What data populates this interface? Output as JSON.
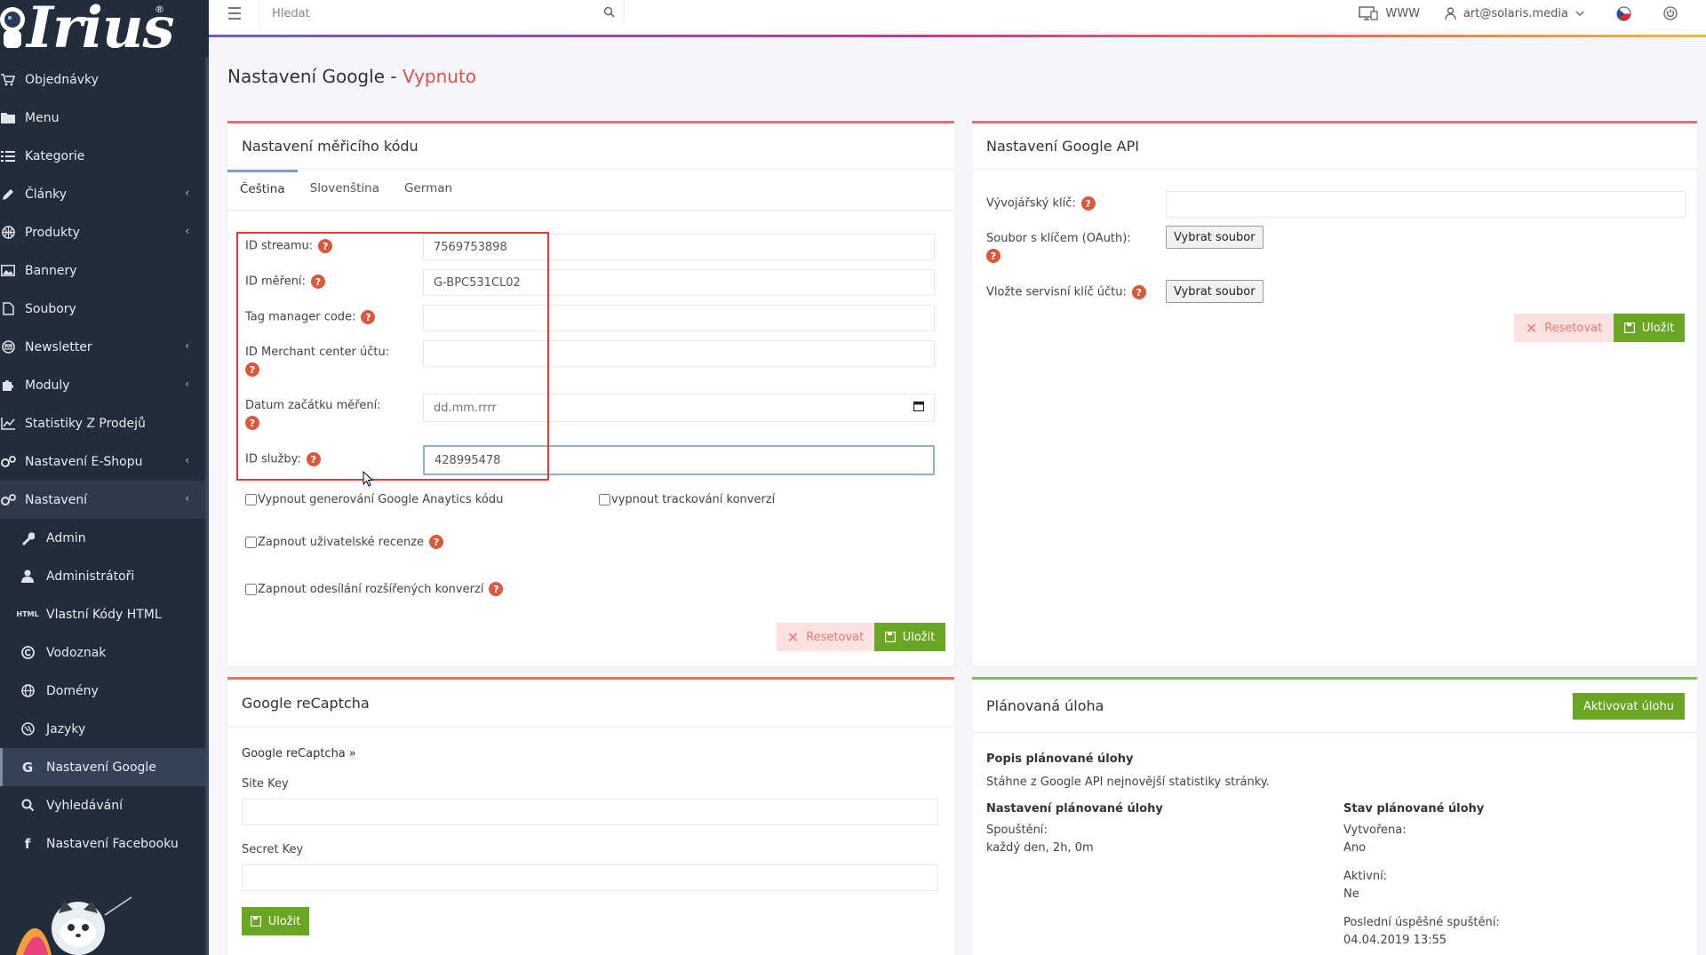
{
  "brand": {
    "logo_text": "Irius",
    "logo_reg": "®"
  },
  "sidebar": {
    "items": [
      {
        "label": "Objednávky",
        "icon": "cart-icon"
      },
      {
        "label": "Menu",
        "icon": "folder-icon"
      },
      {
        "label": "Kategorie",
        "icon": "list-icon"
      },
      {
        "label": "Články",
        "icon": "pencil-icon",
        "chevron": true
      },
      {
        "label": "Produkty",
        "icon": "basketball-icon",
        "chevron": true
      },
      {
        "label": "Bannery",
        "icon": "image-icon"
      },
      {
        "label": "Soubory",
        "icon": "file-icon"
      },
      {
        "label": "Newsletter",
        "icon": "envelope-icon",
        "chevron": true
      },
      {
        "label": "Moduly",
        "icon": "puzzle-icon",
        "chevron": true
      },
      {
        "label": "Statistiky Z Prodejů",
        "icon": "chart-icon"
      },
      {
        "label": "Nastavení E-Shopu",
        "icon": "gears-icon",
        "chevron": true
      },
      {
        "label": "Nastavení",
        "icon": "gears-icon",
        "chevron": true
      }
    ],
    "subitems": [
      {
        "label": "Admin",
        "icon": "wrench-icon"
      },
      {
        "label": "Administrátoři",
        "icon": "user-icon"
      },
      {
        "label": "Vlastní Kódy HTML",
        "icon": "html-icon"
      },
      {
        "label": "Vodoznak",
        "icon": "copyright-icon"
      },
      {
        "label": "Domény",
        "icon": "globe-icon"
      },
      {
        "label": "Jazyky",
        "icon": "language-icon"
      },
      {
        "label": "Nastavení Google",
        "icon": "google-icon"
      },
      {
        "label": "Vyhledávání",
        "icon": "search-icon"
      },
      {
        "label": "Nastavení Facebooku",
        "icon": "facebook-icon"
      }
    ],
    "chevron_glyph": "‹"
  },
  "topbar": {
    "search_placeholder": "Hledat",
    "www_label": "WWW",
    "user_email": "art@solaris.media"
  },
  "page": {
    "title": "Nastavení Google - ",
    "status": "Vypnuto"
  },
  "measure": {
    "title": "Nastavení měřicího kódu",
    "tabs": [
      "Čeština",
      "Slovenština",
      "German"
    ],
    "fields": {
      "stream_id": {
        "label": "ID streamu:",
        "value": "7569753898"
      },
      "measure_id": {
        "label": "ID měření:",
        "value": "G-BPC531CL02"
      },
      "tag_manager": {
        "label": "Tag manager code:",
        "value": ""
      },
      "merchant": {
        "label": "ID Merchant center účtu:",
        "value": ""
      },
      "start_date": {
        "label": "Datum začátku měření:",
        "placeholder": "dd.mm.rrrr"
      },
      "service_id": {
        "label": "ID služby:",
        "value": "428995478"
      }
    },
    "checks": {
      "disable_ga": "Vypnout generování Google Anaytics kódu",
      "disable_conv": "vypnout trackování konverzí",
      "reviews": "Zapnout uživatelské recenze",
      "ext_conv": "Zapnout odesílání rozšířených konverzí"
    },
    "reset_label": "Resetovat",
    "save_label": "Uložit"
  },
  "api": {
    "title": "Nastavení Google API",
    "dev_key_label": "Vývojářský klíč:",
    "oauth_label": "Soubor s klíčem (OAuth):",
    "service_key_label": "Vložte servisní klíč účtu:",
    "file_button": "Vybrat soubor",
    "reset_label": "Resetovat",
    "save_label": "Uložit"
  },
  "recaptcha": {
    "title": "Google reCaptcha",
    "link": "Google reCaptcha »",
    "site_key_label": "Site Key",
    "secret_key_label": "Secret Key",
    "save_label": "Uložit"
  },
  "task": {
    "title": "Plánovaná úloha",
    "activate_label": "Aktivovat úlohu",
    "desc_title": "Popis plánované úlohy",
    "desc_text": "Stáhne z Google API nejnovější statistiky stránky.",
    "settings_title": "Nastavení plánované úlohy",
    "run_label": "Spouštění:",
    "run_value": "každý den, 2h, 0m",
    "state_title": "Stav plánované úlohy",
    "created_label": "Vytvořena:",
    "created_value": "Ano",
    "active_label": "Aktivní:",
    "active_value": "Ne",
    "last_run_label": "Poslední úspěšné spuštění:",
    "last_run_value": "04.04.2019 13:55"
  },
  "colors": {
    "accent_red": "#f26d63",
    "accent_green": "#6aa524",
    "sidebar_bg": "#222d3c",
    "outline_red": "#e23a3a"
  }
}
